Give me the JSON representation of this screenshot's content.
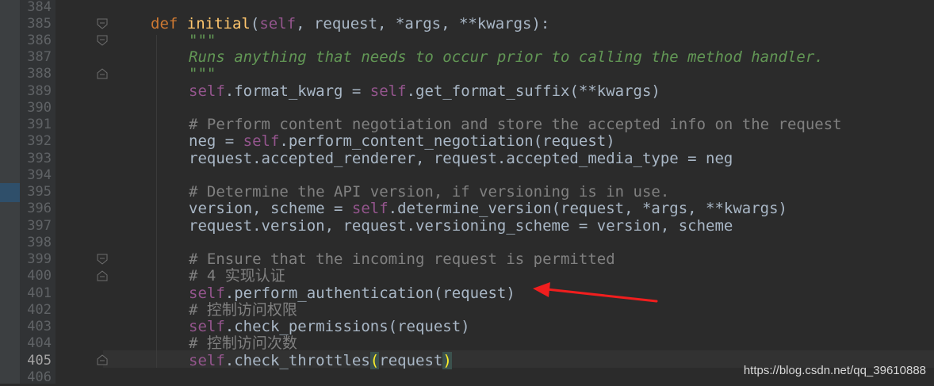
{
  "editor": {
    "line_numbers": [
      "384",
      "385",
      "386",
      "387",
      "388",
      "389",
      "390",
      "391",
      "392",
      "393",
      "394",
      "395",
      "396",
      "397",
      "398",
      "399",
      "400",
      "401",
      "402",
      "403",
      "404",
      "405",
      "406"
    ],
    "current_line": "405",
    "code": {
      "l385": {
        "kw": "def",
        "fn": "initial",
        "open": "(",
        "self": "self",
        "rest": ", request, *args, **kwargs):"
      },
      "l386": {
        "doc": "\"\"\""
      },
      "l387": {
        "doc": "Runs anything that needs to occur prior to calling the method handler."
      },
      "l388": {
        "doc": "\"\"\""
      },
      "l389": {
        "self": "self",
        "rest": ".format_kwarg = ",
        "self2": "self",
        "rest2": ".get_format_suffix(**kwargs)"
      },
      "l391": {
        "comment": "# Perform content negotiation and store the accepted info on the request"
      },
      "l392": {
        "pre": "neg = ",
        "self": "self",
        "rest": ".perform_content_negotiation(request)"
      },
      "l393": {
        "text": "request.accepted_renderer, request.accepted_media_type = neg"
      },
      "l395": {
        "comment": "# Determine the API version, if versioning is in use."
      },
      "l396": {
        "pre": "version, scheme = ",
        "self": "self",
        "rest": ".determine_version(request, *args, **kwargs)"
      },
      "l397": {
        "text": "request.version, request.versioning_scheme = version, scheme"
      },
      "l399": {
        "comment": "# Ensure that the incoming request is permitted"
      },
      "l400": {
        "comment": "# 4 实现认证"
      },
      "l401": {
        "self": "self",
        "rest": ".perform_authentication(request)"
      },
      "l402": {
        "comment": "# 控制访问权限"
      },
      "l403": {
        "self": "self",
        "rest": ".check_permissions(request)"
      },
      "l404": {
        "comment": "# 控制访问次数"
      },
      "l405": {
        "self": "self",
        "rest": ".check_throttles",
        "open": "(",
        "arg": "request",
        "close": ")"
      }
    }
  },
  "annotation": {
    "arrow_color": "#f01e1e"
  },
  "watermark": "https://blog.csdn.net/qq_39610888",
  "colors": {
    "background": "#2b2b2b",
    "keyword": "#cc7832",
    "function": "#ffc66d",
    "self": "#94558d",
    "docstring": "#629755",
    "comment": "#808080"
  }
}
